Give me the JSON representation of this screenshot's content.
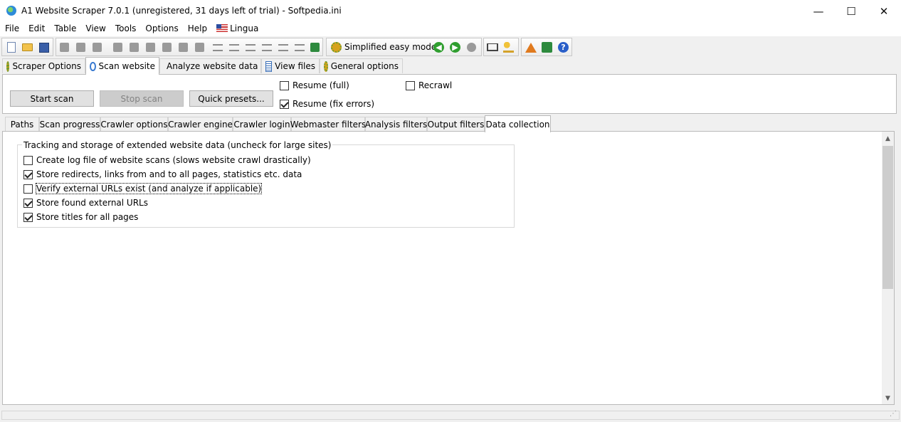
{
  "window": {
    "title": "A1 Website Scraper 7.0.1 (unregistered, 31 days left of trial) - Softpedia.ini",
    "controls": {
      "minimize": "—",
      "maximize": "☐",
      "close": "✕"
    }
  },
  "menu": [
    "File",
    "Edit",
    "Table",
    "View",
    "Tools",
    "Options",
    "Help",
    "Lingua"
  ],
  "toolbar": {
    "simplified_label": "Simplified easy mode"
  },
  "main_tabs": [
    "Scraper Options",
    "Scan website",
    "Analyze website data",
    "View files",
    "General options"
  ],
  "main_tabs_active": "Scan website",
  "scan": {
    "start_label": "Start scan",
    "stop_label": "Stop scan",
    "presets_label": "Quick presets...",
    "resume_full": {
      "label": "Resume (full)",
      "checked": false
    },
    "resume_fix": {
      "label": "Resume (fix errors)",
      "checked": true
    },
    "recrawl": {
      "label": "Recrawl",
      "checked": false
    }
  },
  "sub_tabs": [
    "Paths",
    "Scan progress",
    "Crawler options",
    "Crawler engine",
    "Crawler login",
    "Webmaster filters",
    "Analysis filters",
    "Output filters",
    "Data collection"
  ],
  "sub_tabs_active": "Data collection",
  "data_collection": {
    "group_title": "Tracking and storage of extended website data (uncheck for large sites)",
    "options": [
      {
        "label": "Create log file of website scans (slows website crawl drastically)",
        "checked": false
      },
      {
        "label": "Store redirects, links from and to all pages, statistics etc. data",
        "checked": true
      },
      {
        "label": "Verify external URLs exist (and analyze if applicable)",
        "checked": false
      },
      {
        "label": "Store found external URLs",
        "checked": true
      },
      {
        "label": "Store titles for all pages",
        "checked": true
      }
    ]
  }
}
